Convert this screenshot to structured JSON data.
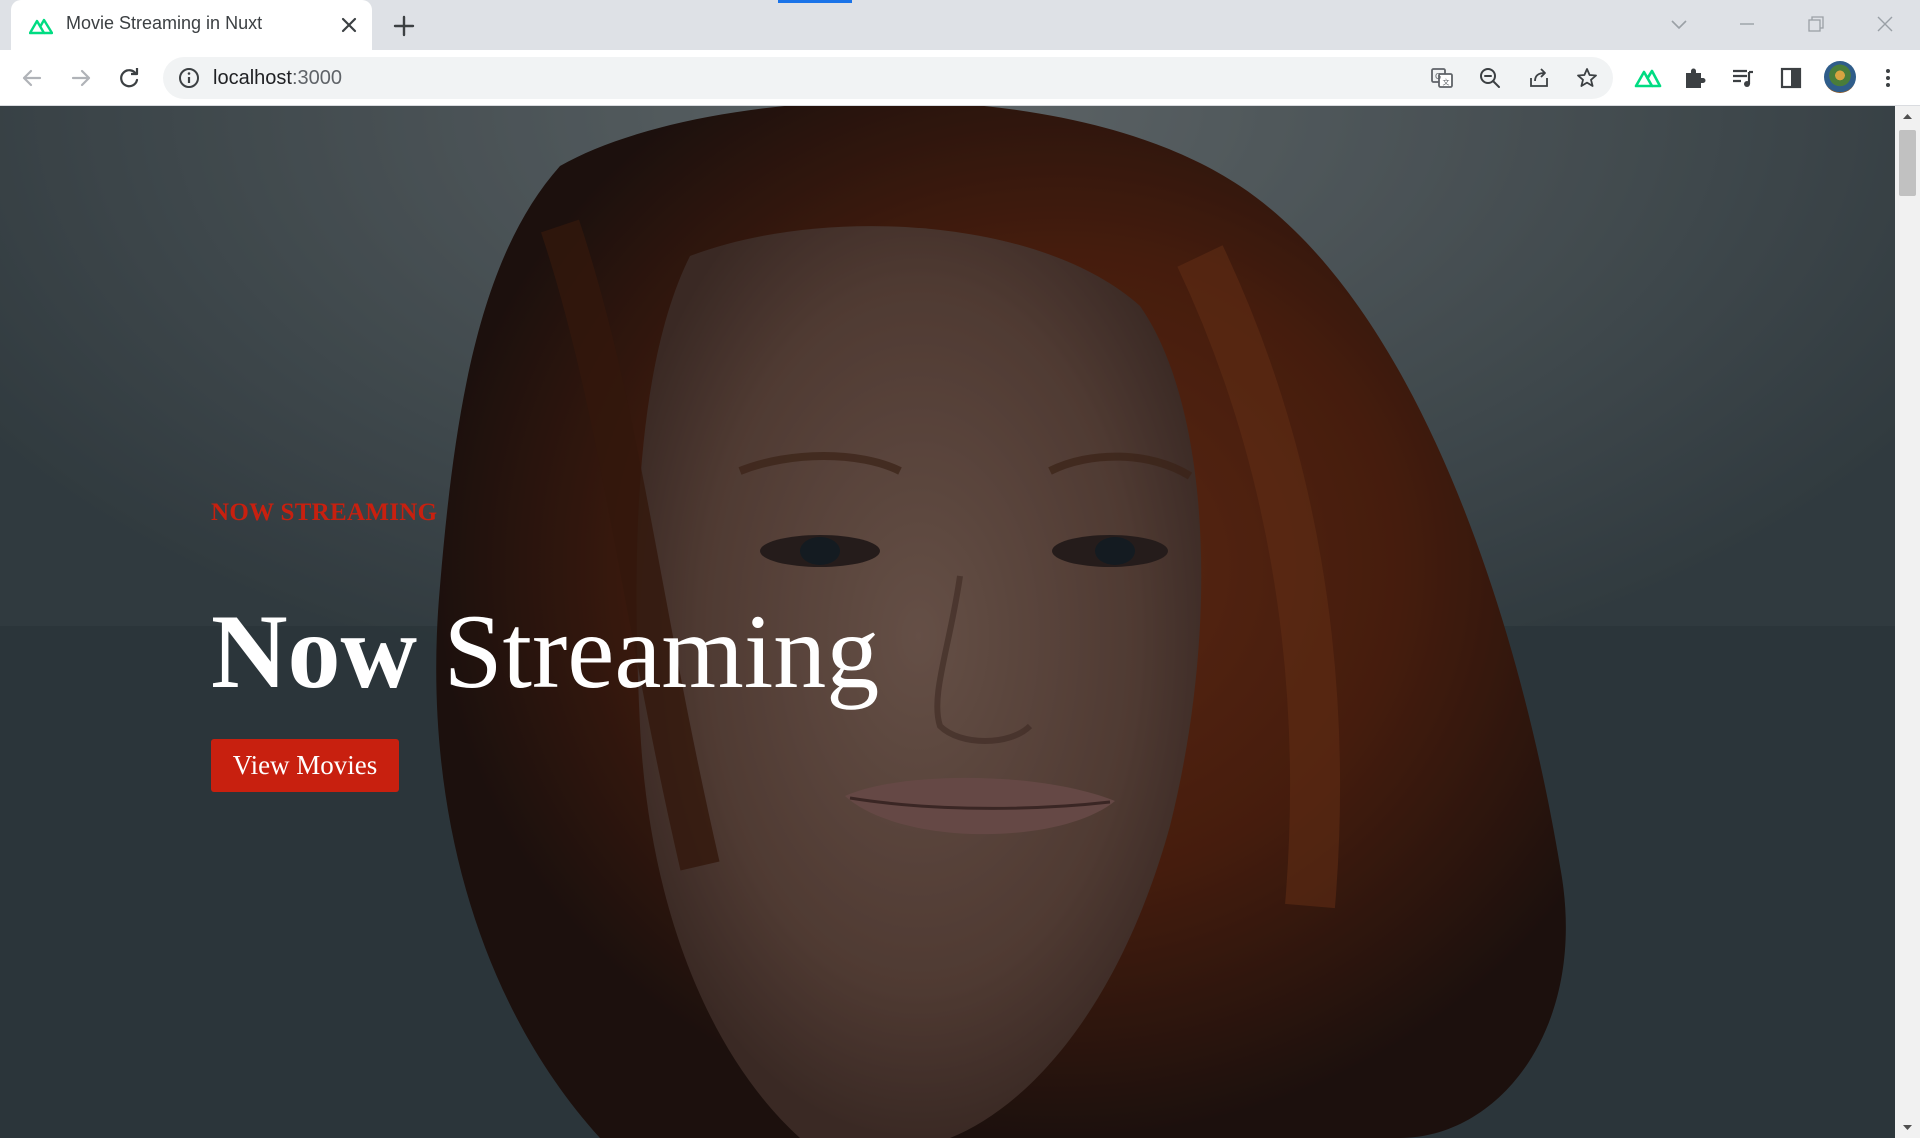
{
  "browser": {
    "tab_title": "Movie Streaming in Nuxt",
    "url_host": "localhost",
    "url_port": ":3000",
    "icons": {
      "favicon": "nuxt-logo-icon",
      "tab_close": "close-icon",
      "new_tab": "plus-icon",
      "back": "back-arrow-icon",
      "forward": "forward-arrow-icon",
      "reload": "reload-icon",
      "site_info": "info-icon",
      "translate": "translate-icon",
      "zoom": "zoom-out-icon",
      "share": "share-icon",
      "bookmark": "star-icon",
      "extension_nuxt": "nuxt-devtools-icon",
      "extensions": "puzzle-icon",
      "media": "media-queue-icon",
      "side_panel": "side-panel-icon",
      "menu": "kebab-menu-icon"
    }
  },
  "hero": {
    "eyebrow": "NOW STREAMING",
    "title_bold": "Now",
    "title_rest": " Streaming",
    "button_label": "View Movies"
  },
  "colors": {
    "accent": "#c8200f",
    "nuxt_green": "#00dc82",
    "title_text": "#ffffff"
  }
}
